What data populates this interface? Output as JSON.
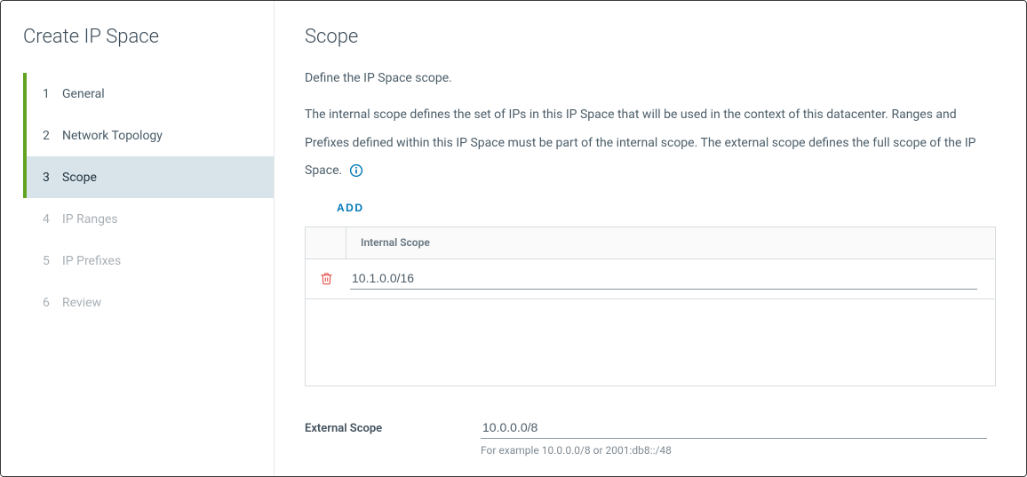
{
  "wizard": {
    "title": "Create IP Space",
    "steps": [
      {
        "num": "1",
        "label": "General",
        "state": "completed"
      },
      {
        "num": "2",
        "label": "Network Topology",
        "state": "completed"
      },
      {
        "num": "3",
        "label": "Scope",
        "state": "active"
      },
      {
        "num": "4",
        "label": "IP Ranges",
        "state": "disabled"
      },
      {
        "num": "5",
        "label": "IP Prefixes",
        "state": "disabled"
      },
      {
        "num": "6",
        "label": "Review",
        "state": "disabled"
      }
    ]
  },
  "page": {
    "title": "Scope",
    "subtitle": "Define the IP Space scope.",
    "description": "The internal scope defines the set of IPs in this IP Space that will be used in the context of this datacenter. Ranges and Prefixes defined within this IP Space must be part of the internal scope. The external scope defines the full scope of the IP Space.",
    "add_label": "ADD",
    "table": {
      "header": "Internal Scope",
      "rows": [
        {
          "value": "10.1.0.0/16"
        }
      ]
    },
    "external": {
      "label": "External Scope",
      "value": "10.0.0.0/8",
      "hint": "For example 10.0.0.0/8 or 2001:db8::/48"
    }
  },
  "icons": {
    "info": "info-icon",
    "delete": "trash-icon"
  }
}
